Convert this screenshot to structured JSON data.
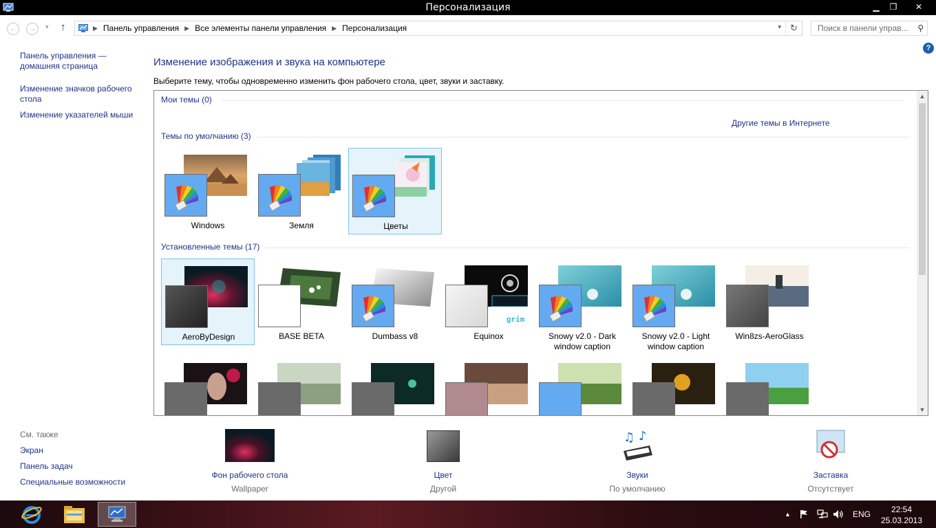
{
  "window": {
    "title": "Персонализация",
    "controls": {
      "minimize": "▁",
      "restore": "❐",
      "close": "✕"
    }
  },
  "nav": {
    "back": "←",
    "forward": "→",
    "recent": "▾",
    "up": "↑",
    "breadcrumb": [
      "Панель управления",
      "Все элементы панели управления",
      "Персонализация"
    ],
    "breadcrumb_sep": "▶",
    "dropdown": "▾",
    "refresh": "↻",
    "search_placeholder": "Поиск в панели управ...",
    "search_icon": "⚲"
  },
  "left_pane": {
    "links": [
      "Панель управления — домашняя страница",
      "Изменение значков рабочего стола",
      "Изменение указателей мыши"
    ],
    "see_also_title": "См. также",
    "see_also": [
      "Экран",
      "Панель задач",
      "Специальные возможности"
    ]
  },
  "help": "?",
  "main": {
    "heading": "Изменение изображения и звука на компьютере",
    "subtitle": "Выберите тему, чтобы одновременно изменить фон рабочего стола, цвет, звуки и заставку.",
    "my_themes_label": "Мои темы (0)",
    "other_themes_link": "Другие темы в Интернете",
    "default_themes_label": "Темы по умолчанию (3)",
    "default_themes": [
      {
        "name": "Windows",
        "selected": false
      },
      {
        "name": "Земля",
        "selected": false
      },
      {
        "name": "Цветы",
        "selected": true
      }
    ],
    "installed_themes_label": "Установленные темы (17)",
    "installed_themes": [
      {
        "name": "AeroByDesign",
        "selected": true
      },
      {
        "name": "BASE BETA",
        "selected": false
      },
      {
        "name": "Dumbass v8",
        "selected": false
      },
      {
        "name": "Equinox",
        "selected": false
      },
      {
        "name": "Snowy v2.0 - Dark window caption",
        "selected": false
      },
      {
        "name": "Snowy v2.0 - Light window caption",
        "selected": false
      },
      {
        "name": "Win8zs-AeroGlass",
        "selected": false
      }
    ],
    "equinox_logo_text": "grim",
    "scroll_up": "▲",
    "scroll_down": "▼"
  },
  "options": [
    {
      "label": "Фон рабочего стола",
      "value": "Wallpaper"
    },
    {
      "label": "Цвет",
      "value": "Другой"
    },
    {
      "label": "Звуки",
      "value": "По умолчанию"
    },
    {
      "label": "Заставка",
      "value": "Отсутствует"
    }
  ],
  "taskbar": {
    "language": "ENG",
    "time": "22:54",
    "date": "25.03.2013",
    "tray_arrow": "▲"
  },
  "colors": {
    "link": "#1e3287",
    "selection_bg": "#e5f3fb",
    "selection_border": "#7dc5ea"
  }
}
